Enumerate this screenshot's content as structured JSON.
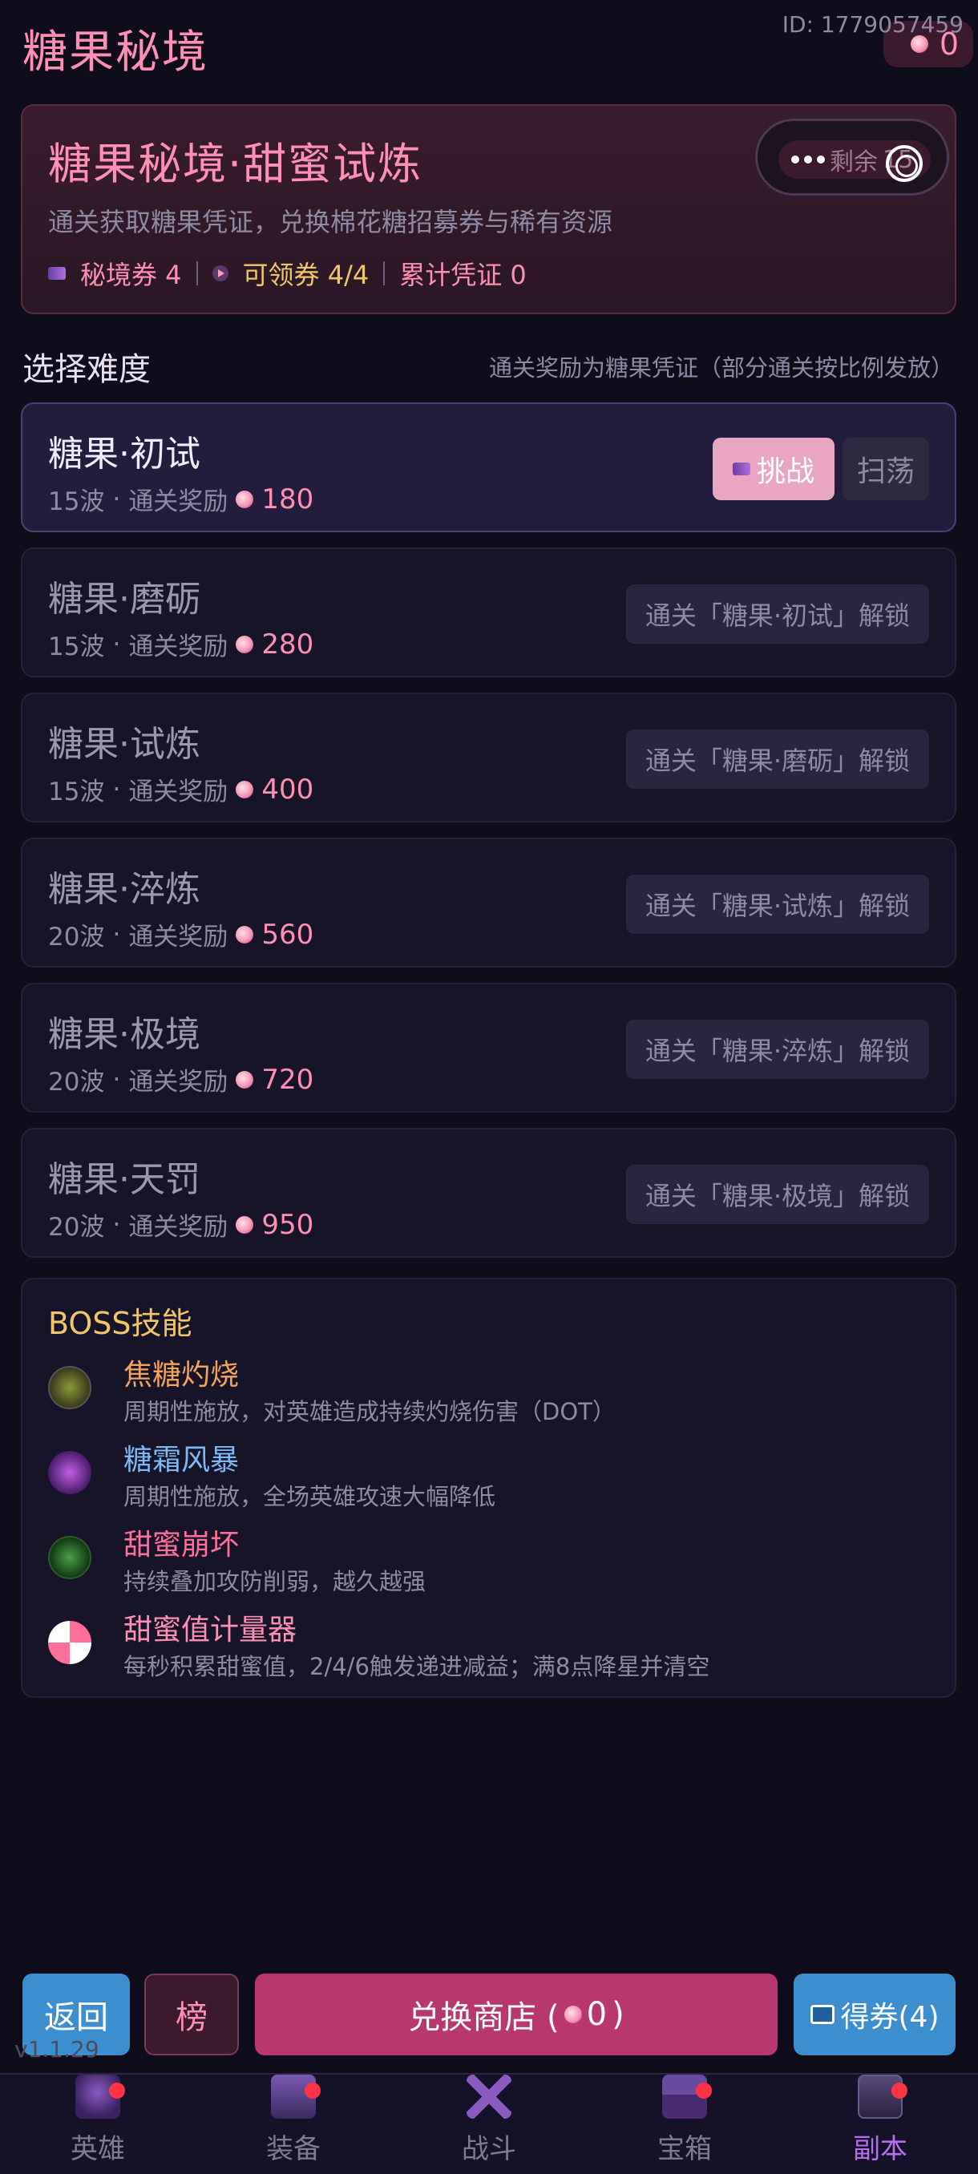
{
  "header": {
    "title": "糖果秘境",
    "user_id": "ID: 1779057459",
    "currency_value": "0"
  },
  "hero": {
    "title": "糖果秘境·甜蜜试炼",
    "subtitle": "通关获取糖果凭证，兑换棉花糖招募券与稀有资源",
    "stat_tickets": "秘境券 4",
    "stat_claimable": "可领券 4/4",
    "stat_vouchers": "累计凭证 0",
    "remain_label": "剩余",
    "remain_value": "15"
  },
  "section": {
    "title": "选择难度",
    "note": "通关奖励为糖果凭证（部分通关按比例发放）"
  },
  "levels": [
    {
      "name": "糖果·初试",
      "waves": "15波",
      "reward_label": "通关奖励",
      "reward": "180",
      "challenge": "挑战",
      "sweep": "扫荡"
    },
    {
      "name": "糖果·磨砺",
      "waves": "15波",
      "reward_label": "通关奖励",
      "reward": "280",
      "lock": "通关「糖果·初试」解锁"
    },
    {
      "name": "糖果·试炼",
      "waves": "15波",
      "reward_label": "通关奖励",
      "reward": "400",
      "lock": "通关「糖果·磨砺」解锁"
    },
    {
      "name": "糖果·淬炼",
      "waves": "20波",
      "reward_label": "通关奖励",
      "reward": "560",
      "lock": "通关「糖果·试炼」解锁"
    },
    {
      "name": "糖果·极境",
      "waves": "20波",
      "reward_label": "通关奖励",
      "reward": "720",
      "lock": "通关「糖果·淬炼」解锁"
    },
    {
      "name": "糖果·天罚",
      "waves": "20波",
      "reward_label": "通关奖励",
      "reward": "950",
      "lock": "通关「糖果·极境」解锁"
    }
  ],
  "boss": {
    "title": "BOSS技能",
    "skills": [
      {
        "name": "焦糖灼烧",
        "desc": "周期性施放，对英雄造成持续灼烧伤害（DOT）",
        "color": "#f3a35a"
      },
      {
        "name": "糖霜风暴",
        "desc": "周期性施放，全场英雄攻速大幅降低",
        "color": "#7fb8f5"
      },
      {
        "name": "甜蜜崩坏",
        "desc": "持续叠加攻防削弱，越久越强",
        "color": "#ff6f9a"
      },
      {
        "name": "甜蜜值计量器",
        "desc": "每秒积累甜蜜值，2/4/6触发递进减益；满8点降星并清空",
        "color": "#ff8fb3"
      }
    ]
  },
  "actions": {
    "back": "返回",
    "rank": "榜",
    "shop_prefix": "兑换商店 (",
    "shop_value": "0",
    "shop_suffix": ")",
    "ticket": "得券(4)"
  },
  "version": "v1.1.29",
  "tabs": [
    {
      "label": "英雄",
      "badge": true
    },
    {
      "label": "装备",
      "badge": true
    },
    {
      "label": "战斗",
      "badge": false
    },
    {
      "label": "宝箱",
      "badge": true
    },
    {
      "label": "副本",
      "badge": true,
      "active": true
    }
  ]
}
